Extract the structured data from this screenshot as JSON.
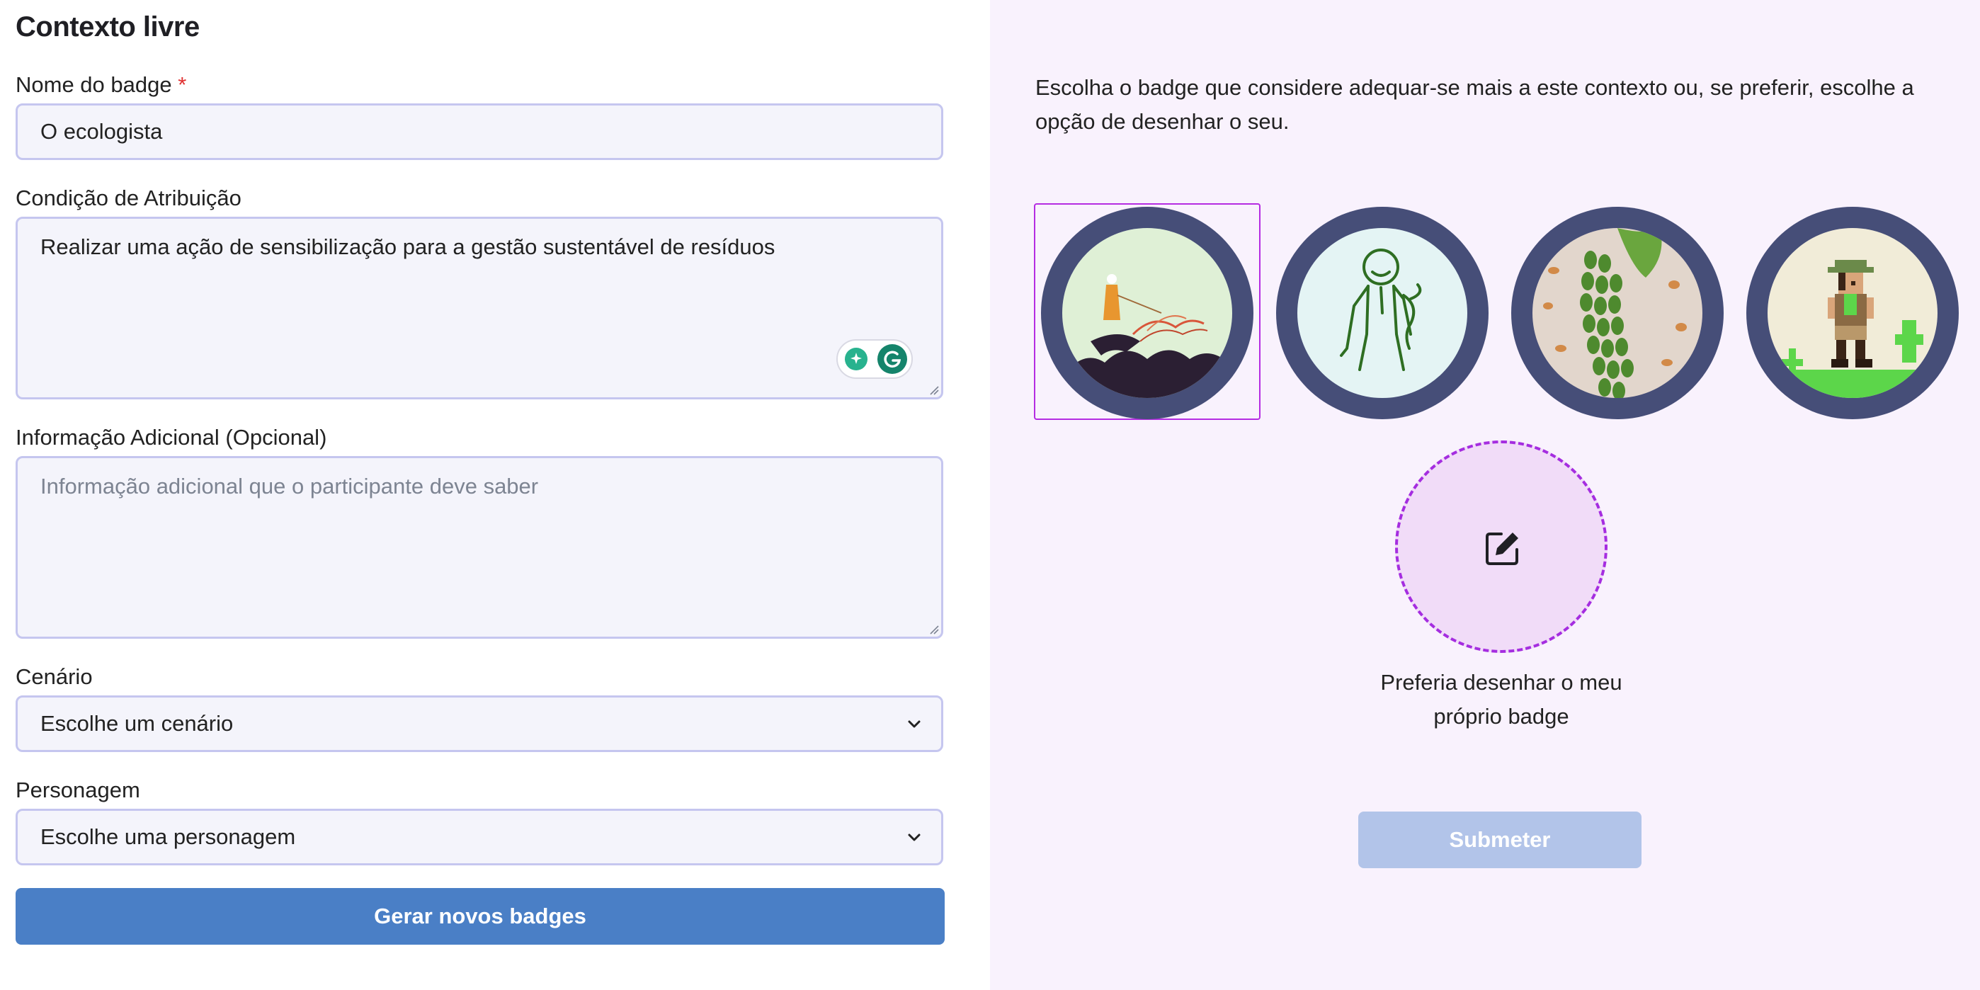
{
  "form": {
    "title": "Contexto livre",
    "badge_name": {
      "label": "Nome do badge",
      "required_mark": "*",
      "value": "O ecologista"
    },
    "condition": {
      "label": "Condição de Atribuição",
      "value": "Realizar uma ação de sensibilização para a gestão sustentável de resíduos"
    },
    "extra_info": {
      "label": "Informação Adicional (Opcional)",
      "placeholder": "Informação adicional que o participante deve saber"
    },
    "scenario": {
      "label": "Cenário",
      "value": "Escolhe um cenário"
    },
    "character": {
      "label": "Personagem",
      "value": "Escolhe uma personagem"
    },
    "generate_button": "Gerar novos badges"
  },
  "picker": {
    "intro": "Escolha o badge que considere adequar-se mais a este contexto ou, se preferir, escolhe a opção de desenhar o seu.",
    "badges": [
      {
        "name": "badge-option-1",
        "selected": true
      },
      {
        "name": "badge-option-2",
        "selected": false
      },
      {
        "name": "badge-option-3",
        "selected": false
      },
      {
        "name": "badge-option-4",
        "selected": false
      }
    ],
    "draw_option_label": "Preferia desenhar o meu próprio badge",
    "draw_icon": "edit-icon",
    "submit_button": "Submeter"
  },
  "colors": {
    "primary_button": "#4a7fc6",
    "submit_disabled": "#b2c4e9",
    "right_panel_bg": "#f9f2fd",
    "badge_ring": "#464e78",
    "selection": "#b52ce2",
    "required": "#e03131"
  }
}
